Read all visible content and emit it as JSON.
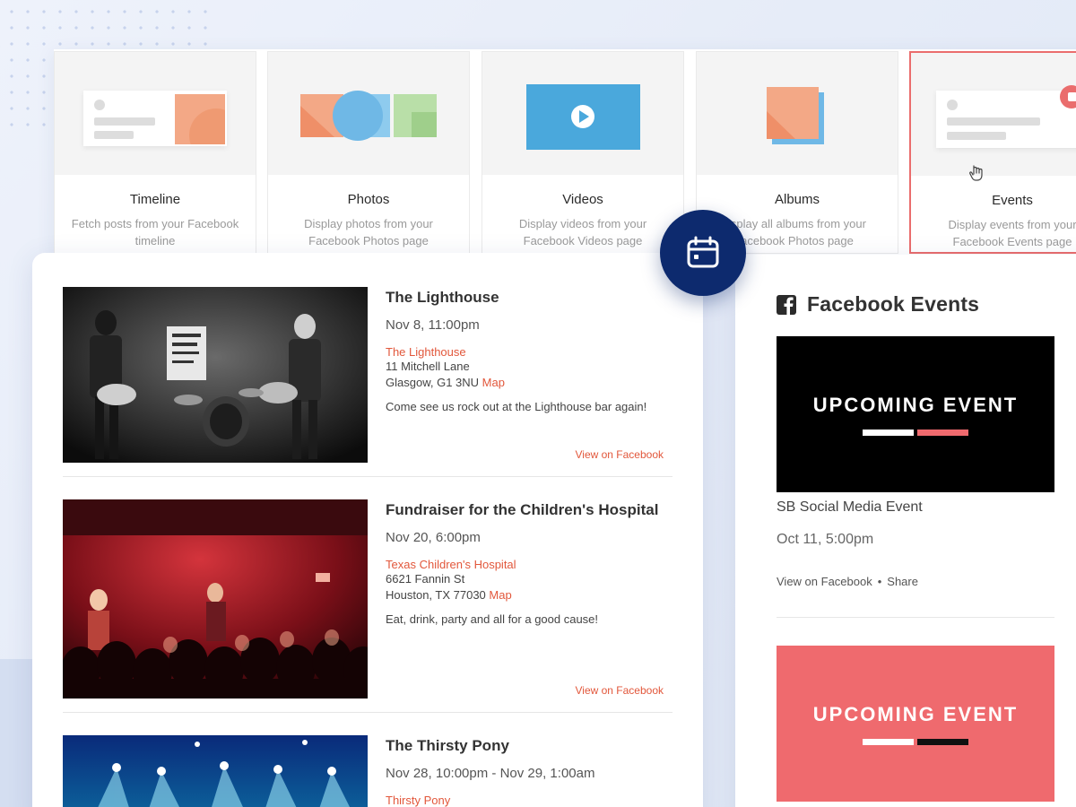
{
  "colors": {
    "accent": "#e2573b",
    "badge": "#0d2a6e",
    "active_border": "#ea6d6d",
    "promo_pink": "#ef6a6e"
  },
  "feed_types": [
    {
      "title": "Timeline",
      "desc": "Fetch posts from your Facebook timeline",
      "icon": "timeline-illustration"
    },
    {
      "title": "Photos",
      "desc": "Display photos from your Facebook Photos page",
      "icon": "photos-illustration"
    },
    {
      "title": "Videos",
      "desc": "Display videos from your Facebook Videos page",
      "icon": "play-icon"
    },
    {
      "title": "Albums",
      "desc": "isplay all albums from your acebook Photos page",
      "icon": "albums-illustration"
    },
    {
      "title": "Events",
      "desc": "Display events from your Facebook Events page",
      "icon": "events-illustration",
      "active": true
    }
  ],
  "events": [
    {
      "title": "The Lighthouse",
      "date": "Nov 8, 11:00pm",
      "venue": "The Lighthouse",
      "address_line1": "11 Mitchell Lane",
      "address_line2": "Glasgow,  G1 3NU",
      "map": "Map",
      "desc": "Come see us rock out at the Lighthouse bar again!",
      "fb_link": "View on Facebook"
    },
    {
      "title": "Fundraiser for the Children's Hospital",
      "date": "Nov 20, 6:00pm",
      "venue": "Texas Children's Hospital",
      "address_line1": "6621 Fannin St",
      "address_line2": "Houston, TX  77030",
      "map": "Map",
      "desc": "Eat, drink, party and all for a good cause!",
      "fb_link": "View on Facebook"
    },
    {
      "title": "The Thirsty Pony",
      "date": "Nov 28, 10:00pm - Nov 29, 1:00am",
      "venue": "Thirsty Pony"
    }
  ],
  "fb_widget": {
    "title": "Facebook Events",
    "promo_text": "UPCOMING EVENT",
    "event_name": "SB Social Media Event",
    "event_date": "Oct 11, 5:00pm",
    "view_link": "View on Facebook",
    "separator": "•",
    "share_link": "Share"
  }
}
